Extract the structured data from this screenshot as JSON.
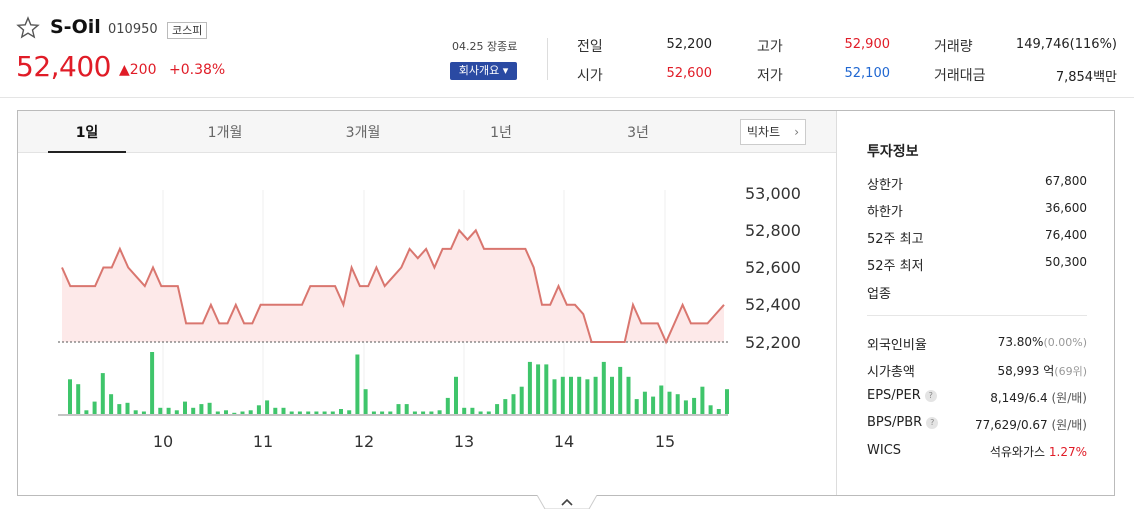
{
  "header": {
    "name": "S-Oil",
    "code": "010950",
    "market": "코스피",
    "price": "52,400",
    "change": "▲200",
    "change_rate": "+0.38%",
    "closing": "04.25 장종료",
    "company_button": "회사개요 ▾"
  },
  "quote": {
    "prev_close": {
      "label": "전일",
      "value": "52,200"
    },
    "open": {
      "label": "시가",
      "value": "52,600"
    },
    "high": {
      "label": "고가",
      "value": "52,900"
    },
    "low": {
      "label": "저가",
      "value": "52,100"
    },
    "volume": {
      "label": "거래량",
      "value": "149,746(116%)"
    },
    "amount": {
      "label": "거래대금",
      "value": "7,854백만"
    }
  },
  "tabs": [
    "1일",
    "1개월",
    "3개월",
    "1년",
    "3년"
  ],
  "active_tab": "1일",
  "big_chart_button": "빅차트",
  "invest": {
    "title": "투자정보",
    "upper_limit": {
      "label": "상한가",
      "value": "67,800"
    },
    "lower_limit": {
      "label": "하한가",
      "value": "36,600"
    },
    "high_52w": {
      "label": "52주 최고",
      "value": "76,400"
    },
    "low_52w": {
      "label": "52주 최저",
      "value": "50,300"
    },
    "sector": {
      "label": "업종"
    },
    "foreign": {
      "label": "외국인비율",
      "value": "73.80%",
      "sub": "(0.00%)"
    },
    "market_cap": {
      "label": "시가총액",
      "value": "58,993 억",
      "sub": "(69위)"
    },
    "eps_per": {
      "label": "EPS/PER",
      "value": "8,149/6.4",
      "sub": " (원/배)"
    },
    "bps_pbr": {
      "label": "BPS/PBR",
      "value": "77,629/0.67",
      "sub": " (원/배)"
    },
    "wics": {
      "label": "WICS",
      "value": "석유와가스",
      "rate": "1.27%"
    }
  },
  "colors": {
    "up": "#e01c27",
    "down": "#2067d1",
    "line": "#d9766f",
    "volume": "#3fc56b"
  },
  "chart_data": {
    "type": "line",
    "x_ticks": [
      "10",
      "11",
      "12",
      "13",
      "14",
      "15"
    ],
    "y_ticks": [
      "53,000",
      "52,800",
      "52,600",
      "52,400",
      "52,200"
    ],
    "ylim": [
      52200,
      53000
    ],
    "prev_close": 52200,
    "price": [
      52600,
      52500,
      52500,
      52500,
      52500,
      52600,
      52600,
      52700,
      52600,
      52550,
      52500,
      52600,
      52500,
      52500,
      52500,
      52300,
      52300,
      52300,
      52400,
      52300,
      52300,
      52400,
      52300,
      52300,
      52400,
      52400,
      52400,
      52400,
      52400,
      52400,
      52500,
      52500,
      52500,
      52500,
      52400,
      52600,
      52500,
      52500,
      52600,
      52500,
      52550,
      52600,
      52700,
      52650,
      52700,
      52600,
      52700,
      52700,
      52800,
      52750,
      52800,
      52700,
      52700,
      52700,
      52700,
      52700,
      52700,
      52600,
      52400,
      52400,
      52500,
      52400,
      52400,
      52350,
      52200,
      52200,
      52200,
      52200,
      52200,
      52400,
      52300,
      52300,
      52300,
      52200,
      52300,
      52400,
      52300,
      52300,
      52300,
      52350,
      52400
    ],
    "volume": [
      28,
      24,
      3,
      10,
      33,
      16,
      8,
      9,
      3,
      2,
      50,
      5,
      5,
      3,
      10,
      5,
      8,
      9,
      2,
      3,
      1,
      2,
      3,
      7,
      11,
      5,
      5,
      2,
      2,
      2,
      2,
      2,
      2,
      4,
      3,
      48,
      20,
      2,
      2,
      2,
      8,
      8,
      2,
      2,
      2,
      3,
      13,
      30,
      5,
      5,
      2,
      2,
      8,
      12,
      16,
      22,
      42,
      40,
      40,
      28,
      30,
      30,
      30,
      28,
      30,
      42,
      30,
      38,
      30,
      12,
      18,
      14,
      23,
      18,
      16,
      11,
      13,
      22,
      7,
      4,
      20
    ]
  }
}
